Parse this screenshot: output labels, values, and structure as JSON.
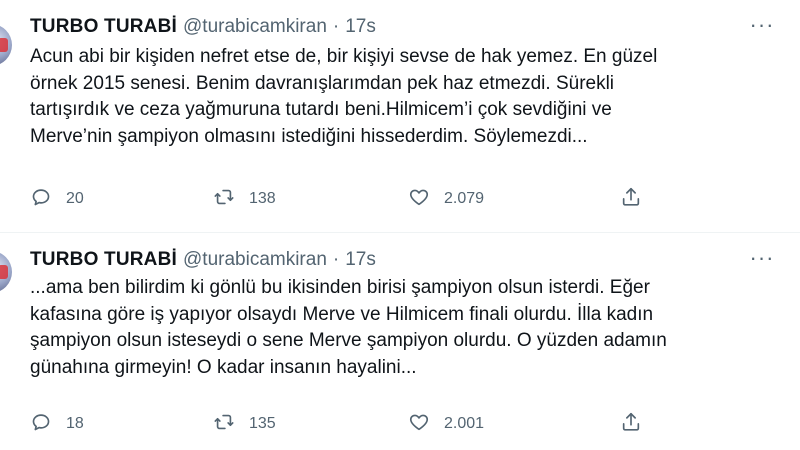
{
  "tweets": [
    {
      "author_name": "TURBO TURABİ",
      "handle": "@turabicamkiran",
      "separator": "·",
      "time": "17s",
      "more_label": "···",
      "lines": [
        "Acun abi bir kişiden nefret etse de, bir kişiyi sevse de hak yemez. En güzel",
        "örnek 2015 senesi. Benim davranışlarımdan pek haz etmezdi. Sürekli",
        "tartışırdık ve ceza yağmuruna tutardı beni.Hilmicem’i çok sevdiğini ve",
        "Merve’nin şampiyon olmasını istediğini hissederdim. Söylemezdi..."
      ],
      "replies": "20",
      "retweets": "138",
      "likes": "2.079"
    },
    {
      "author_name": "TURBO TURABİ",
      "handle": "@turabicamkiran",
      "separator": "·",
      "time": "17s",
      "more_label": "···",
      "lines": [
        "...ama ben bilirdim ki gönlü bu ikisinden birisi şampiyon olsun isterdi. Eğer",
        "kafasına göre iş yapıyor olsaydı Merve ve Hilmicem finali olurdu. İlla kadın",
        "şampiyon olsun isteseydi o sene Merve şampiyon olurdu. O yüzden adamın",
        "günahına girmeyin! O kadar insanın hayalini..."
      ],
      "replies": "18",
      "retweets": "135",
      "likes": "2.001"
    }
  ],
  "icons": {
    "reply": "reply-icon",
    "retweet": "retweet-icon",
    "like": "heart-icon",
    "share": "share-icon",
    "more": "more-icon"
  },
  "colors": {
    "text": "#0f1419",
    "muted": "#536471",
    "divider": "#eff3f4"
  }
}
